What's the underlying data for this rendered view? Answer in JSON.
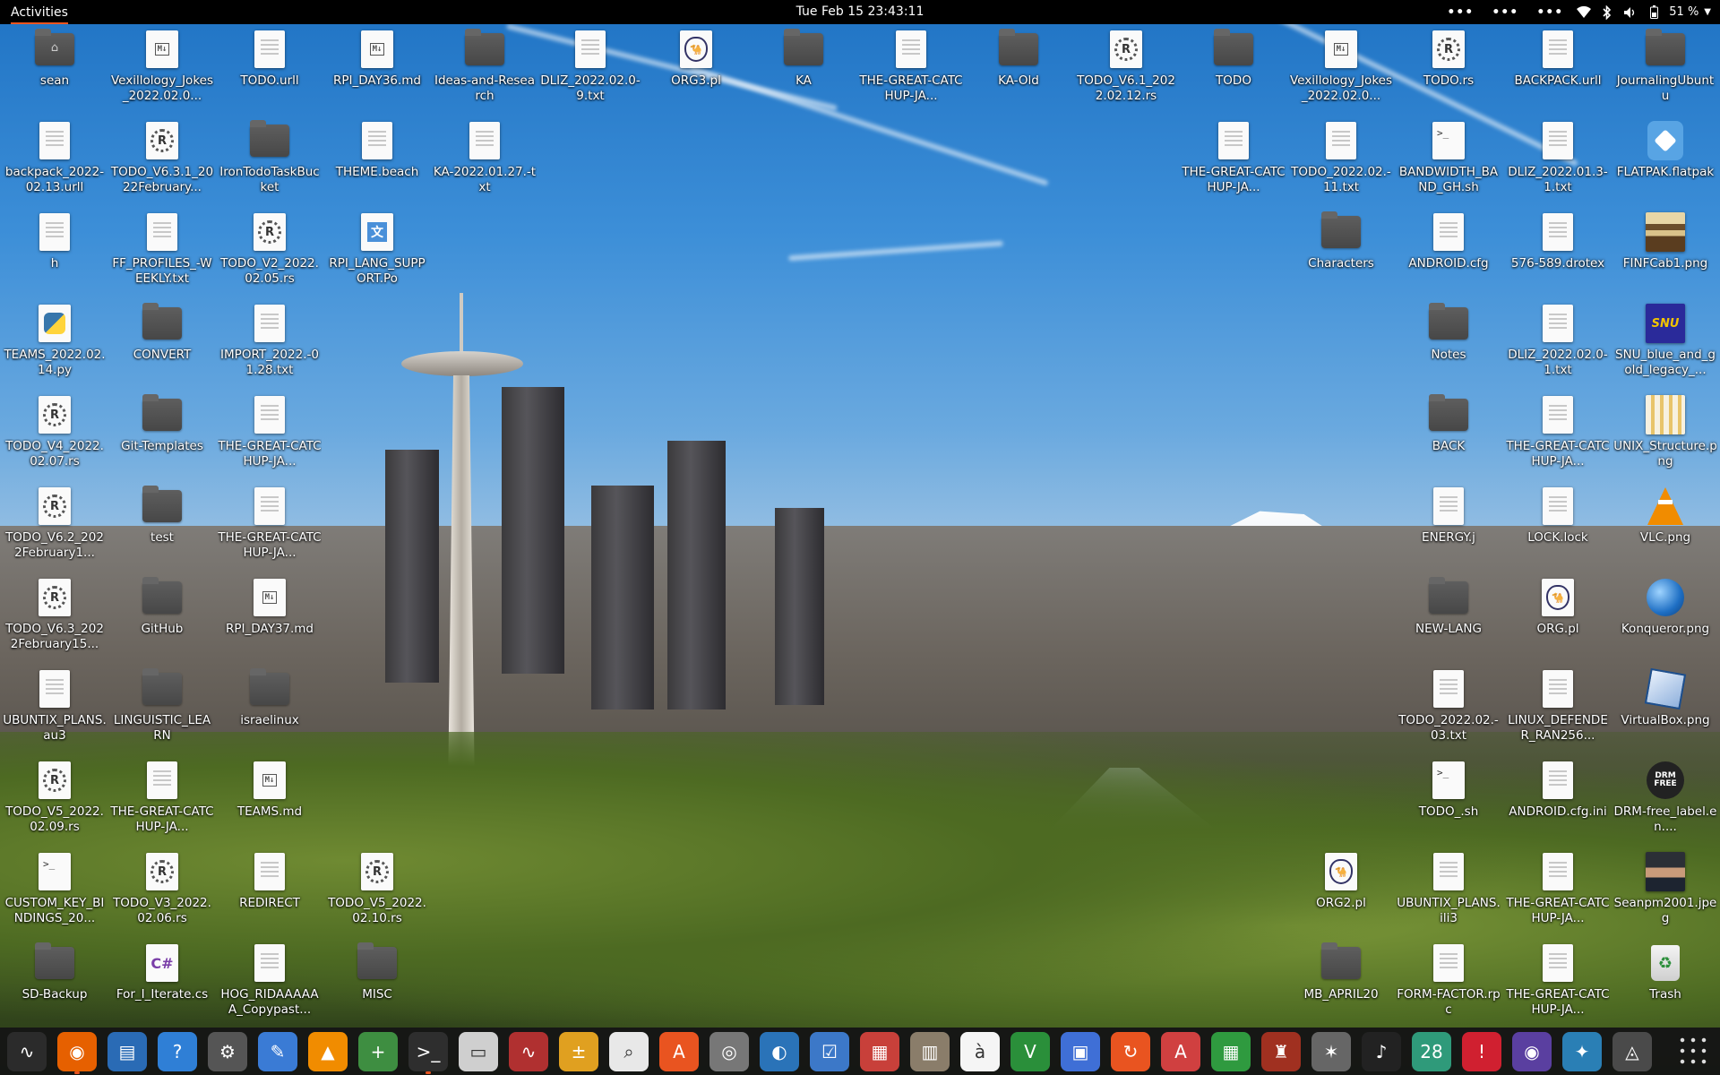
{
  "topbar": {
    "activities": "Activities",
    "clock": "Tue Feb 15  23:43:11",
    "tray": {
      "menus": [
        "•••",
        "•••",
        "•••"
      ],
      "battery": "51 %",
      "icons": [
        "wifi-icon",
        "bluetooth-icon",
        "volume-icon",
        "battery-icon",
        "chevron-down-icon"
      ]
    }
  },
  "desktop": {
    "icons": [
      {
        "label": "sean",
        "type": "home-folder"
      },
      {
        "label": "Vexillology_Jokes_2022.02.0...",
        "type": "md"
      },
      {
        "label": "TODO.urll",
        "type": "doc"
      },
      {
        "label": "RPI_DAY36.md",
        "type": "md"
      },
      {
        "label": "Ideas-and-Research",
        "type": "folder"
      },
      {
        "label": "DLIZ_2022.02.0-9.txt",
        "type": "doc"
      },
      {
        "label": "ORG3.pl",
        "type": "perl"
      },
      {
        "label": "KA",
        "type": "folder"
      },
      {
        "label": "THE-GREAT-CATCHUP-JA...",
        "type": "doc"
      },
      {
        "label": "KA-Old",
        "type": "folder"
      },
      {
        "label": "TODO_V6.1_2022.02.12.rs",
        "type": "rust"
      },
      {
        "label": "TODO",
        "type": "folder"
      },
      {
        "label": "Vexillology_Jokes_2022.02.0...",
        "type": "md"
      },
      {
        "label": "TODO.rs",
        "type": "rust"
      },
      {
        "label": "BACKPACK.urll",
        "type": "doc"
      },
      {
        "label": "JournalingUbuntu",
        "type": "folder"
      },
      {
        "label": "backpack_2022-02.13.urll",
        "type": "doc"
      },
      {
        "label": "TODO_V6.3.1_2022February...",
        "type": "rust"
      },
      {
        "label": "IronTodoTaskBucket",
        "type": "folder"
      },
      {
        "label": "THEME.beach",
        "type": "doc"
      },
      {
        "label": "KA-2022.01.27.-txt",
        "type": "doc"
      },
      {
        "label": "THE-GREAT-CATCHUP-JA...",
        "type": "doc"
      },
      {
        "label": "TODO_2022.02.-11.txt",
        "type": "doc"
      },
      {
        "label": "BANDWIDTH_BAND_GH.sh",
        "type": "script"
      },
      {
        "label": "DLIZ_2022.01.3-1.txt",
        "type": "doc"
      },
      {
        "label": "FLATPAK.flatpak",
        "type": "flatpak"
      },
      {
        "label": "h",
        "type": "doc"
      },
      {
        "label": "FF_PROFILES_-WEEKLY.txt",
        "type": "doc"
      },
      {
        "label": "TODO_V2_2022.02.05.rs",
        "type": "rust"
      },
      {
        "label": "RPI_LANG_SUPPORT.Po",
        "type": "po"
      },
      {
        "label": "Characters",
        "type": "folder"
      },
      {
        "label": "ANDROID.cfg",
        "type": "doc"
      },
      {
        "label": "576-589.drotex",
        "type": "doc"
      },
      {
        "label": "FINFCab1.png",
        "type": "image-cabinet"
      },
      {
        "label": "TEAMS_2022.02.14.py",
        "type": "python"
      },
      {
        "label": "CONVERT",
        "type": "folder"
      },
      {
        "label": "IMPORT_2022.-01.28.txt",
        "type": "doc"
      },
      {
        "label": "Notes",
        "type": "folder"
      },
      {
        "label": "DLIZ_2022.02.0-1.txt",
        "type": "doc"
      },
      {
        "label": "SNU_blue_and_gold_legacy_...",
        "type": "image-snu"
      },
      {
        "label": "TODO_V4_2022.02.07.rs",
        "type": "rust"
      },
      {
        "label": "Git-Templates",
        "type": "folder"
      },
      {
        "label": "THE-GREAT-CATCHUP-JA...",
        "type": "doc"
      },
      {
        "label": "BACK",
        "type": "folder"
      },
      {
        "label": "THE-GREAT-CATCHUP-JA...",
        "type": "doc"
      },
      {
        "label": "UNIX_Structure.png",
        "type": "image-unix"
      },
      {
        "label": "TODO_V6.2_2022February1...",
        "type": "rust"
      },
      {
        "label": "test",
        "type": "folder"
      },
      {
        "label": "THE-GREAT-CATCHUP-JA...",
        "type": "doc"
      },
      {
        "label": "ENERGY.j",
        "type": "doc"
      },
      {
        "label": "LOCK.lock",
        "type": "doc"
      },
      {
        "label": "VLC.png",
        "type": "vlc"
      },
      {
        "label": "TODO_V6.3_2022February15...",
        "type": "rust"
      },
      {
        "label": "GitHub",
        "type": "folder"
      },
      {
        "label": "RPI_DAY37.md",
        "type": "md"
      },
      {
        "label": "NEW-LANG",
        "type": "folder"
      },
      {
        "label": "ORG.pl",
        "type": "perl"
      },
      {
        "label": "Konqueror.png",
        "type": "globe"
      },
      {
        "label": "UBUNTIX_PLANS.au3",
        "type": "doc"
      },
      {
        "label": "LINGUISTIC_LEARN",
        "type": "folder"
      },
      {
        "label": "israelinux",
        "type": "folder"
      },
      {
        "label": "TODO_2022.02.-03.txt",
        "type": "doc"
      },
      {
        "label": "LINUX_DEFENDER_RAN256...",
        "type": "doc"
      },
      {
        "label": "VirtualBox.png",
        "type": "vbox"
      },
      {
        "label": "TODO_V5_2022.02.09.rs",
        "type": "rust"
      },
      {
        "label": "THE-GREAT-CATCHUP-JA...",
        "type": "doc"
      },
      {
        "label": "TEAMS.md",
        "type": "md"
      },
      {
        "label": "TODO_.sh",
        "type": "script"
      },
      {
        "label": "ANDROID.cfg.ini",
        "type": "doc"
      },
      {
        "label": "DRM-free_label.en....",
        "type": "drm"
      },
      {
        "label": "CUSTOM_KEY_BINDINGS_20...",
        "type": "script"
      },
      {
        "label": "TODO_V3_2022.02.06.rs",
        "type": "rust"
      },
      {
        "label": "REDIRECT",
        "type": "doc"
      },
      {
        "label": "TODO_V5_2022.02.10.rs",
        "type": "rust"
      },
      {
        "label": "ORG2.pl",
        "type": "perl"
      },
      {
        "label": "UBUNTIX_PLANS.ili3",
        "type": "doc"
      },
      {
        "label": "THE-GREAT-CATCHUP-JA...",
        "type": "doc"
      },
      {
        "label": "Seanpm2001.jpeg",
        "type": "image-portrait"
      },
      {
        "label": "SD-Backup",
        "type": "folder"
      },
      {
        "label": "For_I_Iterate.cs",
        "type": "csharp"
      },
      {
        "label": "HOG_RIDAAAAAA_Copypast...",
        "type": "doc"
      },
      {
        "label": "MISC",
        "type": "folder"
      },
      {
        "label": "MB_APRIL20",
        "type": "folder"
      },
      {
        "label": "FORM-FACTOR.rpc",
        "type": "doc"
      },
      {
        "label": "THE-GREAT-CATCHUP-JA...",
        "type": "doc"
      },
      {
        "label": "Trash",
        "type": "trash"
      }
    ]
  },
  "dock": {
    "apps": [
      {
        "name": "system-monitor-icon",
        "glyph": "∿",
        "bg": "#2b2b2b"
      },
      {
        "name": "firefox-icon",
        "glyph": "◉",
        "bg": "#e66000"
      },
      {
        "name": "text-document-icon",
        "glyph": "▤",
        "bg": "#2a6bb5"
      },
      {
        "name": "help-icon",
        "glyph": "?",
        "bg": "#2f7fd6"
      },
      {
        "name": "settings-icon",
        "glyph": "⚙",
        "bg": "#555555"
      },
      {
        "name": "text-editor-icon",
        "glyph": "✎",
        "bg": "#3a7bd5"
      },
      {
        "name": "vlc-icon",
        "glyph": "▲",
        "bg": "#f18c00"
      },
      {
        "name": "plus-icon",
        "glyph": "+",
        "bg": "#3e8e41"
      },
      {
        "name": "terminal-icon",
        "glyph": ">_",
        "bg": "#2e2e2e"
      },
      {
        "name": "files-icon",
        "glyph": "▭",
        "bg": "#cfcfcf"
      },
      {
        "name": "chart-icon",
        "glyph": "∿",
        "bg": "#b03030"
      },
      {
        "name": "calculator-icon",
        "glyph": "±",
        "bg": "#e0a020"
      },
      {
        "name": "image-viewer-icon",
        "glyph": "⌕",
        "bg": "#e8e8e8"
      },
      {
        "name": "software-center-icon",
        "glyph": "A",
        "bg": "#e95420"
      },
      {
        "name": "disk-icon",
        "glyph": "◎",
        "bg": "#777777"
      },
      {
        "name": "libreoffice-icon",
        "glyph": "◐",
        "bg": "#2a73b8"
      },
      {
        "name": "tasks-icon",
        "glyph": "☑",
        "bg": "#3c78c8"
      },
      {
        "name": "document-viewer-icon",
        "glyph": "▦",
        "bg": "#c8403a"
      },
      {
        "name": "archive-icon",
        "glyph": "▥",
        "bg": "#8a7d6a"
      },
      {
        "name": "character-map-icon",
        "glyph": "à",
        "bg": "#f5f5f5"
      },
      {
        "name": "vim-icon",
        "glyph": "V",
        "bg": "#2a8f3a"
      },
      {
        "name": "screen-icon",
        "glyph": "▣",
        "bg": "#3f6fd6"
      },
      {
        "name": "update-icon",
        "glyph": "↻",
        "bg": "#e95420"
      },
      {
        "name": "pdf-icon",
        "glyph": "A",
        "bg": "#d04040"
      },
      {
        "name": "spreadsheet-icon",
        "glyph": "▦",
        "bg": "#2f9a3f"
      },
      {
        "name": "game-icon",
        "glyph": "♜",
        "bg": "#a03020"
      },
      {
        "name": "scanner-icon",
        "glyph": "✶",
        "bg": "#666666"
      },
      {
        "name": "music-icon",
        "glyph": "♪",
        "bg": "#222222"
      },
      {
        "name": "calendar-icon",
        "glyph": "28",
        "bg": "#2f9a7a"
      },
      {
        "name": "alert-icon",
        "glyph": "!",
        "bg": "#d02030"
      },
      {
        "name": "screenshot-icon",
        "glyph": "◉",
        "bg": "#5a3fa0"
      },
      {
        "name": "weather-icon",
        "glyph": "✦",
        "bg": "#2a7fb5"
      },
      {
        "name": "backup-icon",
        "glyph": "◬",
        "bg": "#4a4a4a"
      }
    ]
  }
}
